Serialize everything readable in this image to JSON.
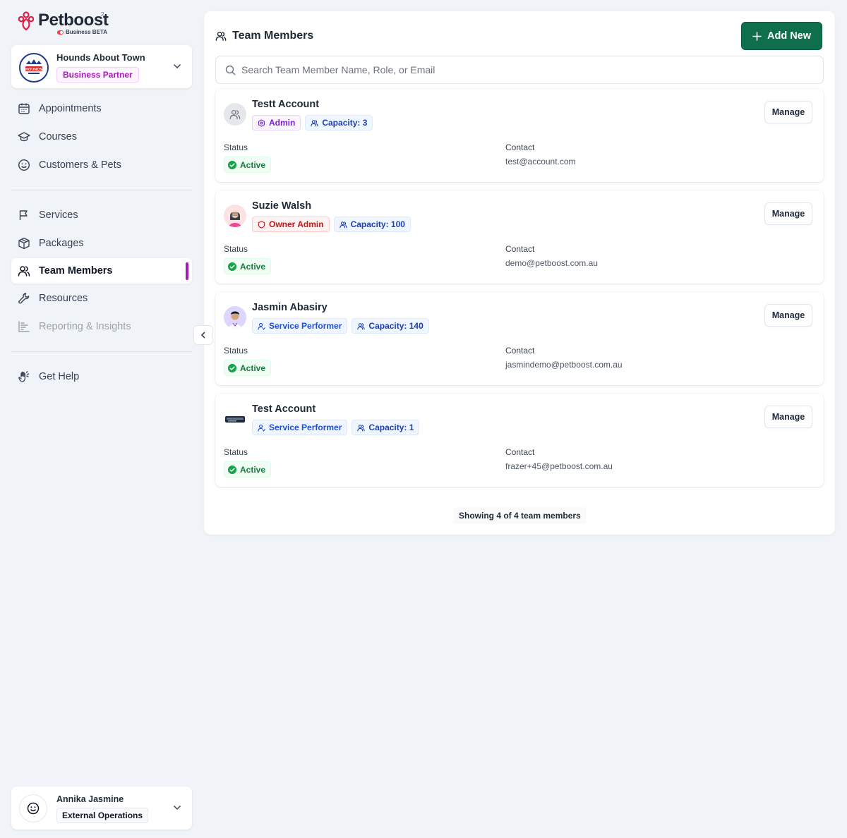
{
  "brand": {
    "name": "Petboost",
    "superscript": "2",
    "sub": "Business BETA",
    "accent": "#e11d48"
  },
  "business": {
    "name": "Hounds About Town",
    "badge": "Business Partner",
    "logo_text": "HOUNDS"
  },
  "nav": {
    "group1": [
      {
        "label": "Appointments",
        "icon": "calendar-icon"
      },
      {
        "label": "Courses",
        "icon": "graduation-cap-icon"
      },
      {
        "label": "Customers & Pets",
        "icon": "smiley-icon"
      }
    ],
    "group2": [
      {
        "label": "Services",
        "icon": "flag-icon"
      },
      {
        "label": "Packages",
        "icon": "box-icon"
      },
      {
        "label": "Team Members",
        "icon": "users-icon",
        "active": true
      },
      {
        "label": "Resources",
        "icon": "wrench-icon"
      },
      {
        "label": "Reporting & Insights",
        "icon": "chart-icon",
        "disabled": true
      }
    ],
    "group3": [
      {
        "label": "Get Help",
        "icon": "hand-icon"
      }
    ]
  },
  "user": {
    "name": "Annika Jasmine",
    "role": "External Operations"
  },
  "page": {
    "title": "Team Members",
    "add_label": "Add New",
    "search_placeholder": "Search Team Member Name, Role, or Email",
    "status_label": "Status",
    "contact_label": "Contact",
    "manage_label": "Manage",
    "footer": "Showing 4 of 4 team members"
  },
  "members": [
    {
      "name": "Testt Account",
      "role": "Admin",
      "role_type": "admin",
      "capacity": "Capacity: 3",
      "status": "Active",
      "email": "test@account.com",
      "avatar": "group-icon"
    },
    {
      "name": "Suzie Walsh",
      "role": "Owner Admin",
      "role_type": "owner",
      "capacity": "Capacity: 100",
      "status": "Active",
      "email": "demo@petboost.com.au",
      "avatar": "woman-avatar"
    },
    {
      "name": "Jasmin Abasiry",
      "role": "Service Performer",
      "role_type": "perf",
      "capacity": "Capacity: 140",
      "status": "Active",
      "email": "jasmindemo@petboost.com.au",
      "avatar": "man-avatar"
    },
    {
      "name": "Test Account",
      "role": "Service Performer",
      "role_type": "perf",
      "capacity": "Capacity: 1",
      "status": "Active",
      "email": "frazer+45@petboost.com.au",
      "avatar": "device-avatar"
    }
  ],
  "colors": {
    "primary_button": "#0f6e4c",
    "active_indicator": "#a21caf",
    "status_active": "#15803d"
  }
}
